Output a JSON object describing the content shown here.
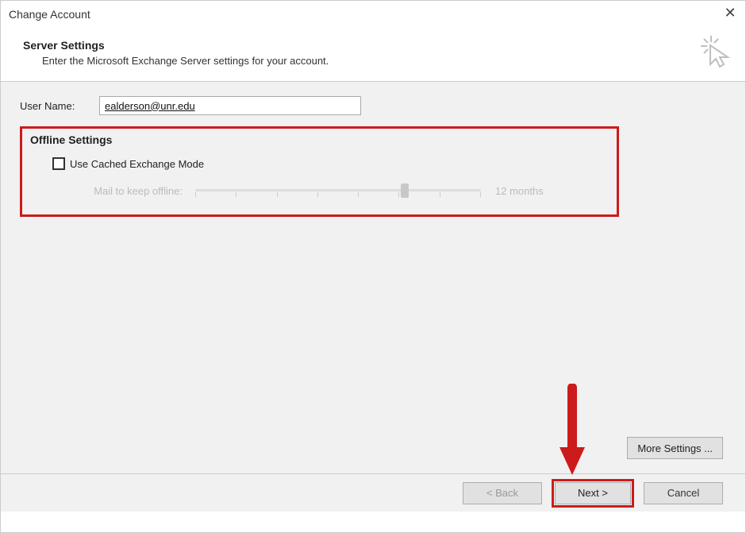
{
  "window": {
    "title": "Change Account"
  },
  "header": {
    "title": "Server Settings",
    "subtitle": "Enter the Microsoft Exchange Server settings for your account."
  },
  "user": {
    "label": "User Name:",
    "value": "ealderson@unr.edu"
  },
  "offline": {
    "group_title": "Offline Settings",
    "checkbox_label": "Use Cached Exchange Mode",
    "checked": false,
    "slider_label": "Mail to keep offline:",
    "slider_value_label": "12 months"
  },
  "buttons": {
    "more_settings": "More Settings ...",
    "back": "< Back",
    "next": "Next >",
    "cancel": "Cancel"
  }
}
